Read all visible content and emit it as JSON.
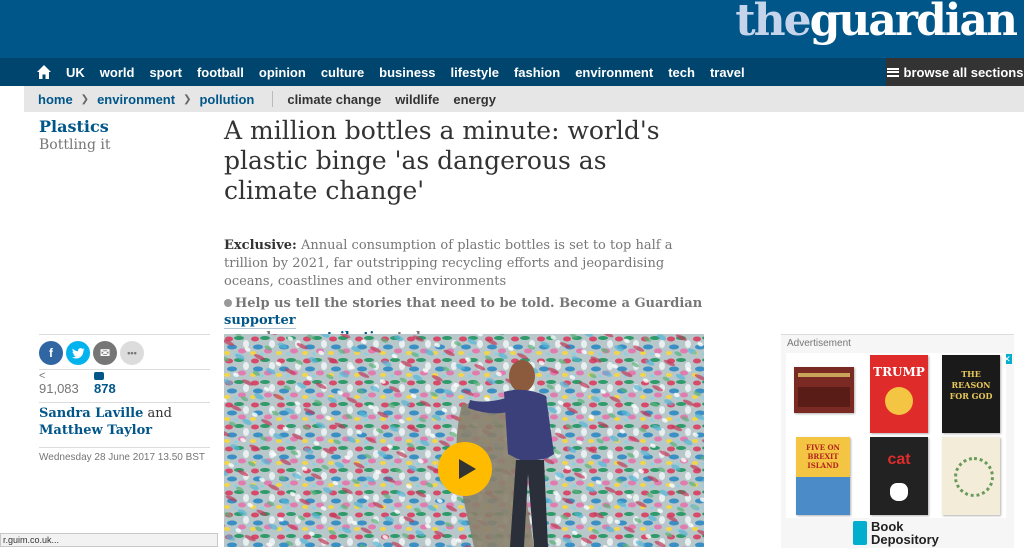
{
  "masthead": {
    "logo_the": "the",
    "logo_guardian": "guardian"
  },
  "nav": {
    "home_icon": "home-icon",
    "items": [
      "UK",
      "world",
      "sport",
      "football",
      "opinion",
      "culture",
      "business",
      "lifestyle",
      "fashion",
      "environment",
      "tech",
      "travel"
    ],
    "browse_label": "browse all sections"
  },
  "breadcrumbs": [
    "home",
    "environment",
    "pollution"
  ],
  "tags": [
    "climate change",
    "wildlife",
    "energy"
  ],
  "section": {
    "title": "Plastics",
    "subtitle": "Bottling it"
  },
  "article": {
    "headline": "A million bottles a minute: world's plastic binge 'as dangerous as climate change'",
    "standfirst_lead": "Exclusive:",
    "standfirst_body": " Annual consumption of plastic bottles is set to top half a trillion by 2021, far outstripping recycling efforts and jeopardising oceans, coastlines and other environments",
    "support_text_1": "Help us tell the stories that need to be told. Become a Guardian ",
    "support_link_1": "supporter",
    "support_text_2": "or make a ",
    "support_link_2": "contribution",
    "support_text_3": " today"
  },
  "meta": {
    "share_count": "91,083",
    "comment_count": "878",
    "author_1": "Sandra Laville",
    "byline_and": " and ",
    "author_2": "Matthew Taylor",
    "dateline": "Wednesday 28 June 2017 13.50 BST"
  },
  "share_buttons": [
    {
      "name": "facebook",
      "glyph": "f",
      "color": "#3067a3"
    },
    {
      "name": "twitter",
      "glyph": "t",
      "color": "#03b3ee"
    },
    {
      "name": "email",
      "glyph": "✉",
      "color": "#767676"
    },
    {
      "name": "more",
      "glyph": "•••",
      "color": "#dcdcdc"
    }
  ],
  "advertisement": {
    "label": "Advertisement",
    "close_glyph": "✕",
    "books": [
      {
        "title": "",
        "bg": "#7a2a22"
      },
      {
        "title": "TRUMP",
        "bg": "#e02b2b"
      },
      {
        "title": "THE REASON FOR GOD",
        "bg": "#1a1a1a"
      },
      {
        "title": "FIVE ON BREXIT ISLAND",
        "bg": "#f4c542"
      },
      {
        "title": "cat",
        "bg": "#222222"
      },
      {
        "title": "",
        "bg": "#f2ecd8"
      }
    ],
    "brand_line_1": "Book",
    "brand_line_2": "Depository"
  },
  "status_bar": {
    "text": "r.guim.co.uk..."
  },
  "colors": {
    "brand_blue": "#005689",
    "nav_blue": "#00456e",
    "play_yellow": "#ffbb00"
  }
}
